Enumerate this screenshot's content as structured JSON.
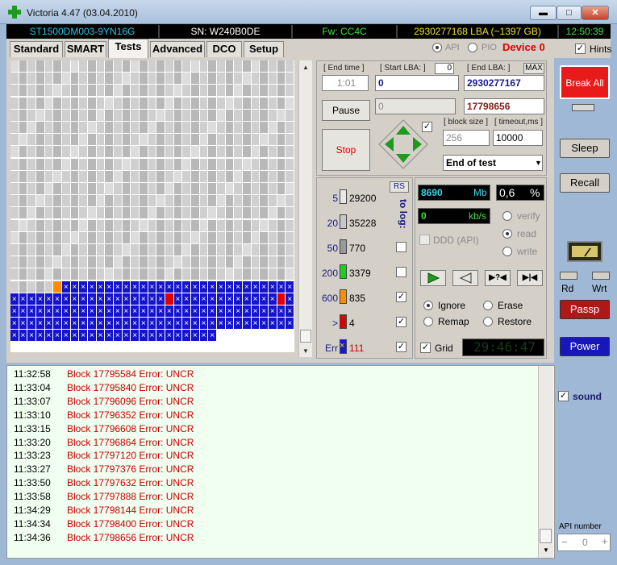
{
  "window": {
    "title": "Victoria 4.47 (03.04.2010)"
  },
  "infobar": {
    "model": "ST1500DM003-9YN16G",
    "serial": "SN: W240B0DE",
    "firmware": "Fw: CC4C",
    "lba": "2930277168 LBA (~1397 GB)",
    "clock": "12:50:39"
  },
  "tabs": [
    "Standard",
    "SMART",
    "Tests",
    "Advanced",
    "DCO",
    "Setup"
  ],
  "mode": {
    "api": "API",
    "pio": "PIO",
    "device": "Device 0",
    "hints": "Hints"
  },
  "controls": {
    "end_time_label": "[ End time ]",
    "end_time_value": "1:01",
    "start_lba_label": "[ Start LBA: ]",
    "start_lba_small": "0",
    "start_lba_value": "0",
    "end_lba_label": "[ End LBA: ]",
    "max_label": "MAX",
    "end_lba_value": "2930277167",
    "current_lba_grey": "0",
    "current_lba": "17798656",
    "pause": "Pause",
    "stop": "Stop",
    "block_size_label": "[ block size ]",
    "block_size": "256",
    "timeout_label": "[ timeout,ms ]",
    "timeout": "10000",
    "end_action": "End of test"
  },
  "stats": {
    "rs": "RS",
    "to_log": "to log:",
    "rows": [
      {
        "ms": "5",
        "count": "29200",
        "color": "#e8e8e8",
        "checked": false,
        "logbox": false
      },
      {
        "ms": "20",
        "count": "35228",
        "color": "#c8c8c8",
        "checked": false,
        "logbox": false
      },
      {
        "ms": "50",
        "count": "770",
        "color": "#9a9a9a",
        "checked": false,
        "logbox": true
      },
      {
        "ms": "200",
        "count": "3379",
        "color": "#22cc22",
        "checked": false,
        "logbox": true
      },
      {
        "ms": "600",
        "count": "835",
        "color": "#ff8c00",
        "checked": true,
        "logbox": true
      },
      {
        "ms": ">",
        "count": "4",
        "color": "#e00000",
        "checked": true,
        "logbox": true
      },
      {
        "ms": "Err",
        "count": "111",
        "color": "#1a1acc",
        "checked": true,
        "logbox": true
      }
    ]
  },
  "readout": {
    "mb": "8690",
    "mb_unit": "Mb",
    "pct": "0,6",
    "pct_unit": "%",
    "speed": "0",
    "speed_unit": "kb/s",
    "ddd": "DDD (API)",
    "verify": "verify",
    "read": "read",
    "write": "write",
    "ignore": "Ignore",
    "erase": "Erase",
    "remap": "Remap",
    "restore": "Restore",
    "grid": "Grid",
    "elapsed": "29:46:47"
  },
  "sidebar": {
    "break_all": "Break All",
    "sleep": "Sleep",
    "recall": "Recall",
    "rd": "Rd",
    "wrt": "Wrt",
    "passp": "Passp",
    "power": "Power",
    "sound": "sound",
    "api_number_label": "API number",
    "api_number": "0"
  },
  "log": [
    {
      "time": "11:32:58",
      "msg": "Block 17795584 Error: UNCR"
    },
    {
      "time": "11:33:04",
      "msg": "Block 17795840 Error: UNCR"
    },
    {
      "time": "11:33:07",
      "msg": "Block 17796096 Error: UNCR"
    },
    {
      "time": "11:33:10",
      "msg": "Block 17796352 Error: UNCR"
    },
    {
      "time": "11:33:15",
      "msg": "Block 17796608 Error: UNCR"
    },
    {
      "time": "11:33:20",
      "msg": "Block 17796864 Error: UNCR"
    },
    {
      "time": "11:33:23",
      "msg": "Block 17797120 Error: UNCR"
    },
    {
      "time": "11:33:27",
      "msg": "Block 17797376 Error: UNCR"
    },
    {
      "time": "11:33:50",
      "msg": "Block 17797632 Error: UNCR"
    },
    {
      "time": "11:33:58",
      "msg": "Block 17797888 Error: UNCR"
    },
    {
      "time": "11:34:29",
      "msg": "Block 17798144 Error: UNCR"
    },
    {
      "time": "11:34:34",
      "msg": "Block 17798400 Error: UNCR"
    },
    {
      "time": "11:34:36",
      "msg": "Block 17798656 Error: UNCR"
    }
  ]
}
